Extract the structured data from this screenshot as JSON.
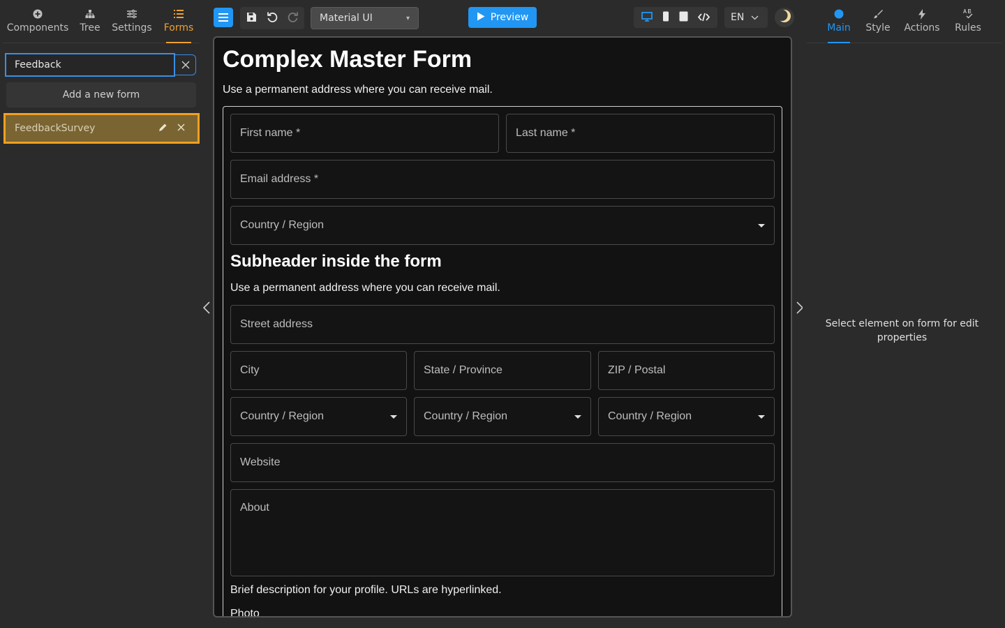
{
  "left_panel": {
    "tabs": [
      {
        "label": "Components",
        "icon": "plus-circle-icon"
      },
      {
        "label": "Tree",
        "icon": "tree-icon"
      },
      {
        "label": "Settings",
        "icon": "sliders-icon"
      },
      {
        "label": "Forms",
        "icon": "list-icon",
        "active": true
      }
    ],
    "search": {
      "value": "Feedback"
    },
    "add_form_label": "Add a new form",
    "forms": [
      {
        "name": "FeedbackSurvey",
        "selected": true
      }
    ]
  },
  "toolbar": {
    "theme_select": "Material UI",
    "preview_label": "Preview",
    "language": "EN"
  },
  "form": {
    "title": "Complex Master Form",
    "description": "Use a permanent address where you can receive mail.",
    "fields": {
      "first_name": "First name *",
      "last_name": "Last name *",
      "email": "Email address *",
      "country": "Country / Region",
      "street": "Street address",
      "city": "City",
      "state": "State / Province",
      "zip": "ZIP / Postal",
      "country_a": "Country / Region",
      "country_b": "Country / Region",
      "country_c": "Country / Region",
      "website": "Website",
      "about": "About"
    },
    "subheader": "Subheader inside the form",
    "subheader_desc": "Use a permanent address where you can receive mail.",
    "about_helper": "Brief description for your profile. URLs are hyperlinked.",
    "photo_label": "Photo"
  },
  "right_panel": {
    "tabs": [
      {
        "label": "Main",
        "icon": "dot-icon",
        "active": true
      },
      {
        "label": "Style",
        "icon": "brush-icon"
      },
      {
        "label": "Actions",
        "icon": "bolt-icon"
      },
      {
        "label": "Rules",
        "icon": "rules-icon"
      }
    ],
    "hint": "Select element on form for edit properties"
  },
  "colors": {
    "accent_orange": "#f0a030",
    "accent_blue": "#2196f3",
    "background": "#2b2b2b",
    "canvas": "#121212"
  }
}
